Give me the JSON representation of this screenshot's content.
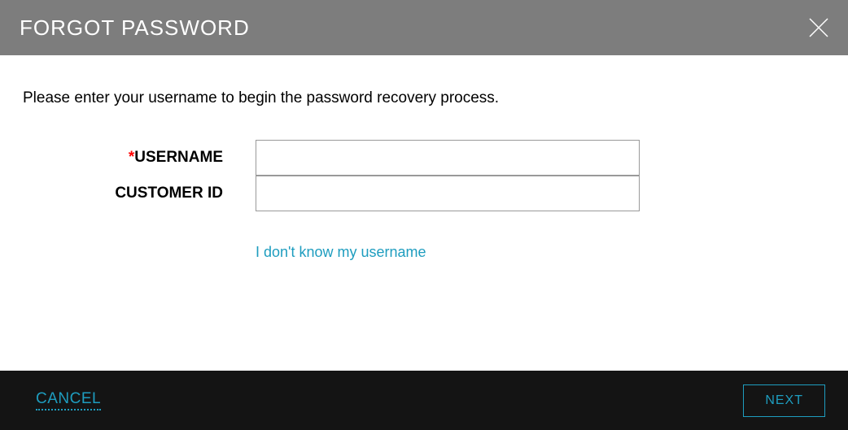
{
  "header": {
    "title": "FORGOT PASSWORD"
  },
  "content": {
    "instructions": "Please enter your username to begin the password recovery process.",
    "fields": {
      "username": {
        "label": "USERNAME",
        "required_mark": "*",
        "value": ""
      },
      "customer_id": {
        "label": "CUSTOMER ID",
        "value": ""
      }
    },
    "link_text": "I don't know my username"
  },
  "footer": {
    "cancel_label": "CANCEL",
    "next_label": "NEXT"
  }
}
